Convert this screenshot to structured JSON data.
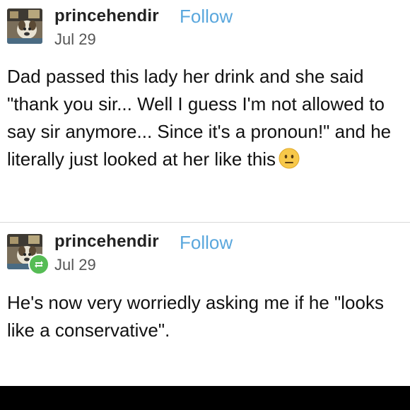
{
  "posts": [
    {
      "username": "princehendir",
      "follow_label": "Follow",
      "date": "Jul 29",
      "text": "Dad passed this lady her drink and she said\n\"thank you sir... Well I guess I'm not allowed to\nsay sir anymore... Since it's a pronoun!\" and he\nliterally just looked at her like this",
      "emoji": "neutral-face-emoji"
    },
    {
      "username": "princehendir",
      "follow_label": "Follow",
      "date": "Jul 29",
      "text": "He's now very worriedly asking me if he \"looks\nlike a conservative\".",
      "badge": "reblog-icon"
    }
  ],
  "colors": {
    "follow": "#5aa7dd",
    "reblog_badge": "#56bc55",
    "divider": "#d9d9d9"
  }
}
